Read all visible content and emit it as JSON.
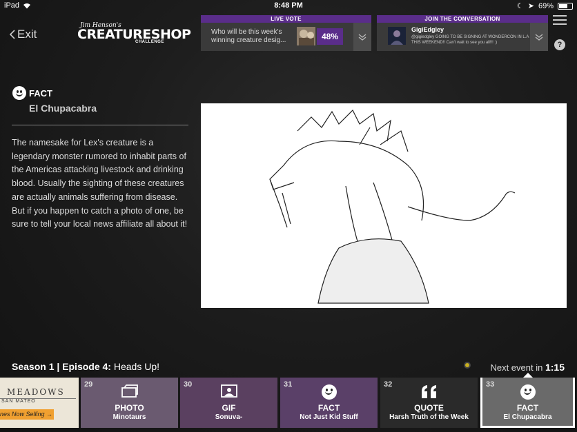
{
  "status_bar": {
    "device": "iPad",
    "time": "8:48 PM",
    "battery": "69%",
    "battery_level": 0.69
  },
  "nav": {
    "exit_label": "Exit"
  },
  "logo": {
    "signature": "Jim Henson's",
    "title": "CREATURESHOP",
    "subtitle": "CHALLENGE"
  },
  "live_vote": {
    "header": "LIVE VOTE",
    "question": "Who will be this week's winning creature desig...",
    "percent": "48%"
  },
  "conversation": {
    "header": "JOIN THE CONVERSATION",
    "user": "GigiEdgley",
    "message": "@gigiedgley GOING TO BE SIGNING AT WONDERCON IN L.A THIS WEEKEND!! Can't wait to see you all!!! :)"
  },
  "help": {
    "label": "?"
  },
  "fact": {
    "label": "FACT",
    "title": "El Chupacabra",
    "body": "The namesake for Lex's creature is a legendary monster rumored to inhabit parts of the Americas attacking livestock and drinking blood. Usually the sighting of these creatures are actually animals suffering from disease. But if you happen to catch a photo of one, be sure to tell your local news affiliate all about it!"
  },
  "episode": {
    "prefix": "Season 1 | Episode 4:",
    "name": "Heads Up!"
  },
  "next_event": {
    "label": "Next event in",
    "time": "1:15"
  },
  "ad": {
    "title": "MEADOWS",
    "subtitle": "SAN MATEO",
    "button": "nes Now Selling →"
  },
  "timeline": [
    {
      "num": "29",
      "type": "PHOTO",
      "title": "Minotaurs",
      "color": "#6a5a70",
      "icon": "photo-icon"
    },
    {
      "num": "30",
      "type": "GIF",
      "title": "Sonuva-",
      "color": "#5a4060",
      "icon": "gif-icon"
    },
    {
      "num": "31",
      "type": "FACT",
      "title": "Not Just Kid Stuff",
      "color": "#5a4068",
      "icon": "smile-icon"
    },
    {
      "num": "32",
      "type": "QUOTE",
      "title": "Harsh Truth of the Week",
      "color": "#2a2a2a",
      "icon": "quote-icon"
    },
    {
      "num": "33",
      "type": "FACT",
      "title": "El Chupacabra",
      "color": "#6a6a6a",
      "icon": "smile-icon"
    }
  ]
}
